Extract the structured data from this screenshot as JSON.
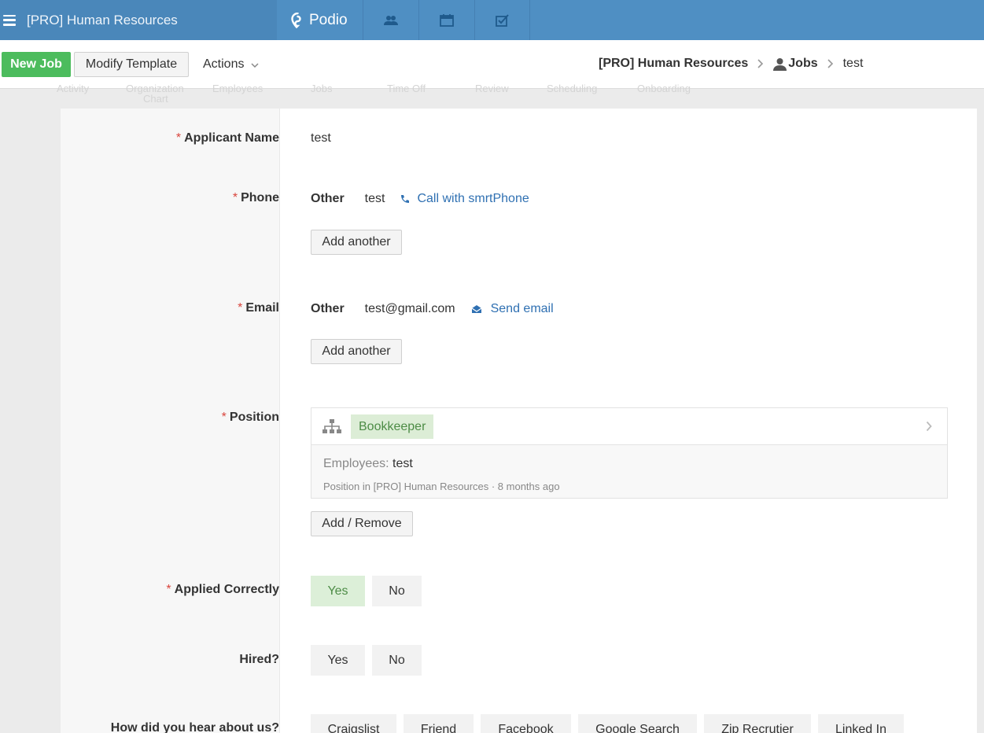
{
  "topnav": {
    "workspace": "[PRO] Human Resources",
    "brand": "Podio",
    "icons": [
      "contacts-icon",
      "calendar-icon",
      "tasks-icon"
    ]
  },
  "toolbar": {
    "new_label": "New Job",
    "modify_label": "Modify Template",
    "actions_label": "Actions",
    "breadcrumb": {
      "workspace": "[PRO] Human Resources",
      "app": "Jobs",
      "item": "test"
    }
  },
  "ghost_tabs": [
    "Activity",
    "Organization",
    "Chart",
    "Employees",
    "Jobs",
    "Time Off",
    "Review",
    "Scheduling",
    "Onboarding"
  ],
  "form": {
    "applicant": {
      "label": "Applicant Name",
      "value": "test"
    },
    "phone": {
      "label": "Phone",
      "type": "Other",
      "value": "test",
      "action": "Call with smrtPhone",
      "add": "Add another"
    },
    "email": {
      "label": "Email",
      "type": "Other",
      "value": "test@gmail.com",
      "action": "Send email",
      "add": "Add another"
    },
    "position": {
      "label": "Position",
      "tag": "Bookkeeper",
      "employees_label": "Employees:",
      "employees_value": "test",
      "meta": "Position in [PRO] Human Resources · 8 months ago",
      "button": "Add / Remove"
    },
    "applied": {
      "label": "Applied Correctly",
      "yes": "Yes",
      "no": "No",
      "selected": "Yes"
    },
    "hired": {
      "label": "Hired?",
      "yes": "Yes",
      "no": "No"
    },
    "source": {
      "label": "How did you hear about us?",
      "options": [
        "Craigslist",
        "Friend",
        "Facebook",
        "Google Search",
        "Zip Recrutier",
        "Linked In"
      ]
    }
  },
  "colors": {
    "nav": "#4f8fc3",
    "primary_button": "#4cbc5d",
    "required": "#d9453d",
    "link": "#2f70b2",
    "selected_bg": "#dcefd8"
  }
}
